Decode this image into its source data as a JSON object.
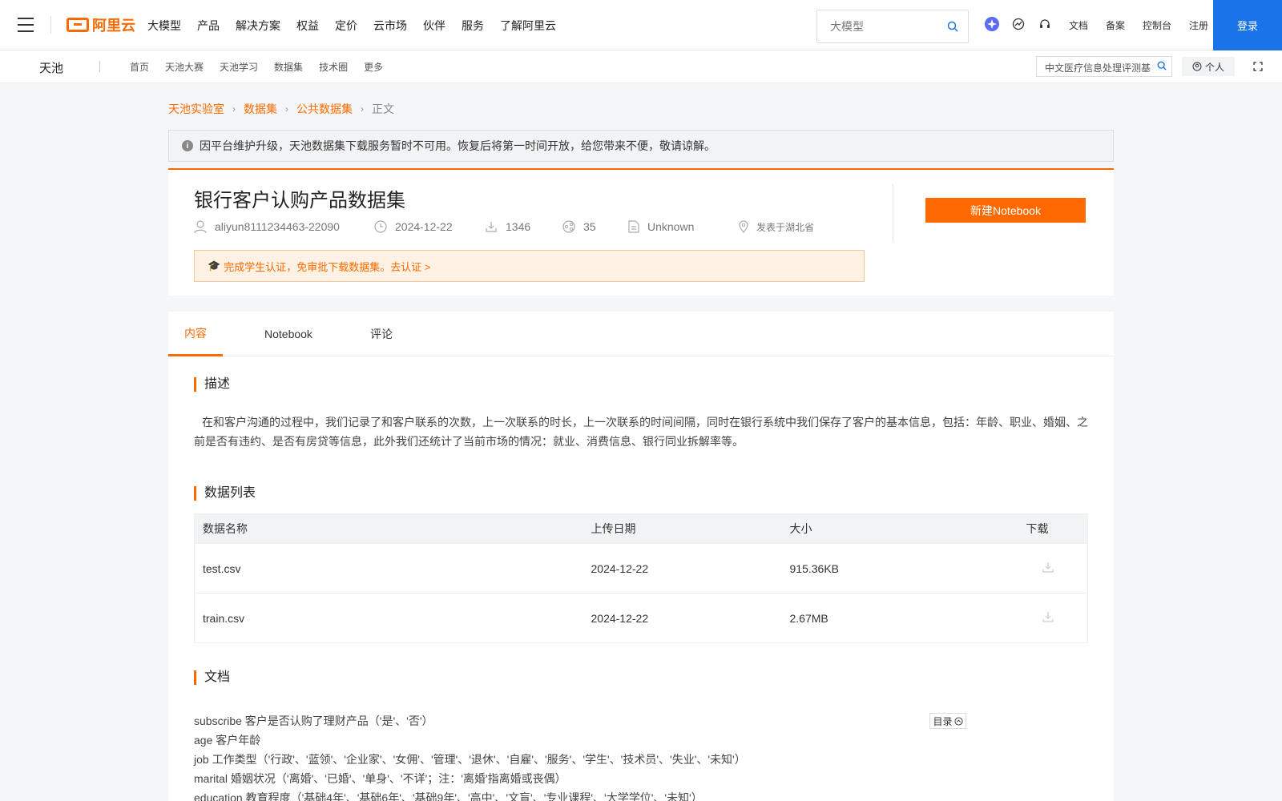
{
  "topbar": {
    "brand": "阿里云",
    "nav": [
      "大模型",
      "产品",
      "解决方案",
      "权益",
      "定价",
      "云市场",
      "伙伴",
      "服务",
      "了解阿里云"
    ],
    "search_placeholder": "大模型",
    "links": [
      "文档",
      "备案",
      "控制台",
      "注册"
    ],
    "login": "登录"
  },
  "subbar": {
    "brand": "天池",
    "nav": [
      "首页",
      "天池大赛",
      "天池学习",
      "数据集",
      "技术圈",
      "更多"
    ],
    "search_value": "中文医疗信息处理评测基",
    "personal": "个人"
  },
  "breadcrumb": [
    "天池实验室",
    "数据集",
    "公共数据集",
    "正文"
  ],
  "notice": "因平台维护升级，天池数据集下载服务暂时不可用。恢复后将第一时间开放，给您带来不便，敬请谅解。",
  "dataset": {
    "title": "银行客户认购产品数据集",
    "author": "aliyun8111234463-22090",
    "date": "2024-12-22",
    "downloads": "1346",
    "shares": "35",
    "license": "Unknown",
    "location": "发表于湖北省",
    "cert": "完成学生认证，免审批下载数据集。去认证 >",
    "new_notebook": "新建Notebook"
  },
  "tabs": [
    "内容",
    "Notebook",
    "评论"
  ],
  "sections": {
    "desc_title": "描述",
    "desc": "在和客户沟通的过程中，我们记录了和客户联系的次数，上一次联系的时长，上一次联系的时间间隔，同时在银行系统中我们保存了客户的基本信息，包括：年龄、职业、婚姻、之前是否有违约、是否有房贷等信息，此外我们还统计了当前市场的情况：就业、消费信息、银行同业拆解率等。",
    "list_title": "数据列表",
    "table": {
      "headers": [
        "数据名称",
        "上传日期",
        "大小",
        "下载"
      ],
      "rows": [
        {
          "name": "test.csv",
          "date": "2024-12-22",
          "size": "915.36KB"
        },
        {
          "name": "train.csv",
          "date": "2024-12-22",
          "size": "2.67MB"
        }
      ]
    },
    "doc_title": "文档",
    "doc_lines": [
      "subscribe 客户是否认购了理财产品（'是'、'否'）",
      "age 客户年龄",
      "job 工作类型（'行政'、'蓝领'、'企业家'、'女佣'、'管理'、'退休'、'自雇'、'服务'、'学生'、'技术员'、'失业'、'未知'）",
      "marital 婚姻状况（'离婚'、'已婚'、'单身'、'不详'；注：'离婚'指离婚或丧偶）",
      "education 教育程度（'基础4年'、'基础6年'、'基础9年'、'高中'、'文盲'、'专业课程'、'大学学位'、'未知'）"
    ],
    "toc": "目录"
  },
  "colors": {
    "accent": "#ff6a00",
    "login_bg": "#1a73e8"
  }
}
